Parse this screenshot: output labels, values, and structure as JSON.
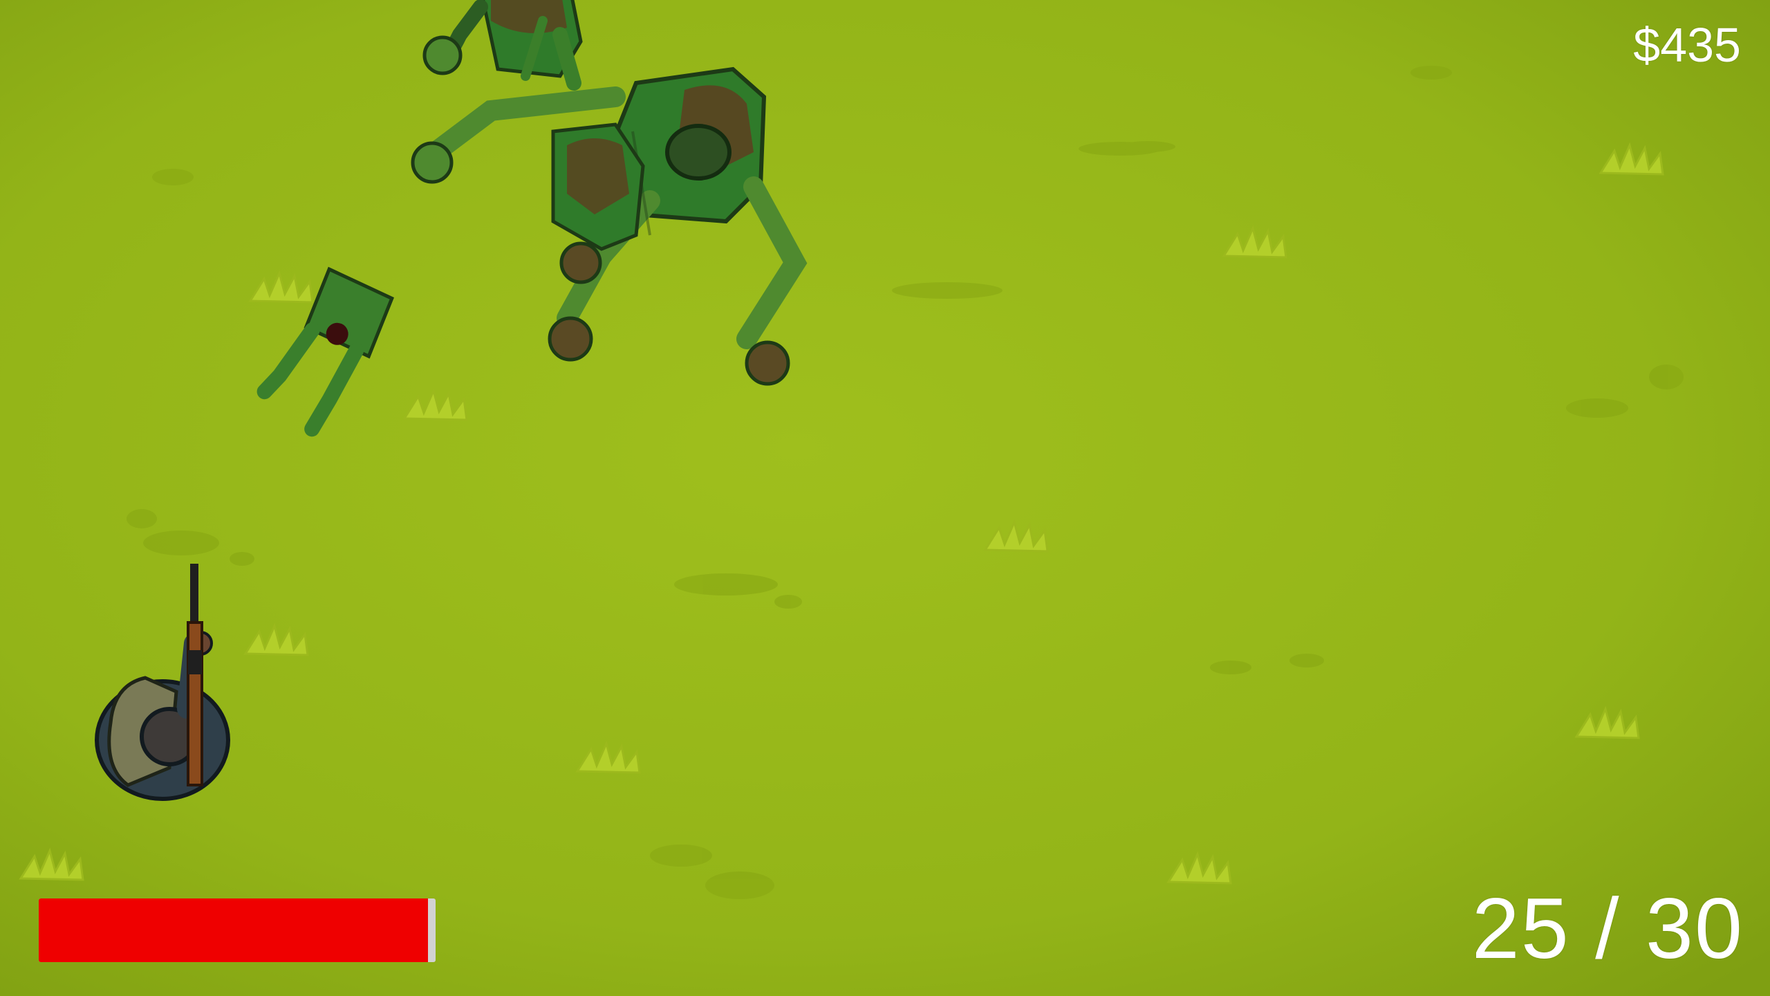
{
  "hud": {
    "money": "$435",
    "ammo": "25 / 30",
    "health": {
      "fraction": 0.98,
      "fill_color": "#ef0000",
      "track_color": "#d2d2d2"
    }
  },
  "scene": {
    "ground_color": "#8fb018",
    "entities": [
      {
        "kind": "player",
        "icon": "soldier-with-rifle-icon"
      },
      {
        "kind": "zombie",
        "icon": "zombie-icon"
      },
      {
        "kind": "zombie",
        "icon": "zombie-icon"
      },
      {
        "kind": "zombie",
        "icon": "zombie-icon"
      },
      {
        "kind": "zombie",
        "icon": "zombie-icon"
      }
    ]
  }
}
